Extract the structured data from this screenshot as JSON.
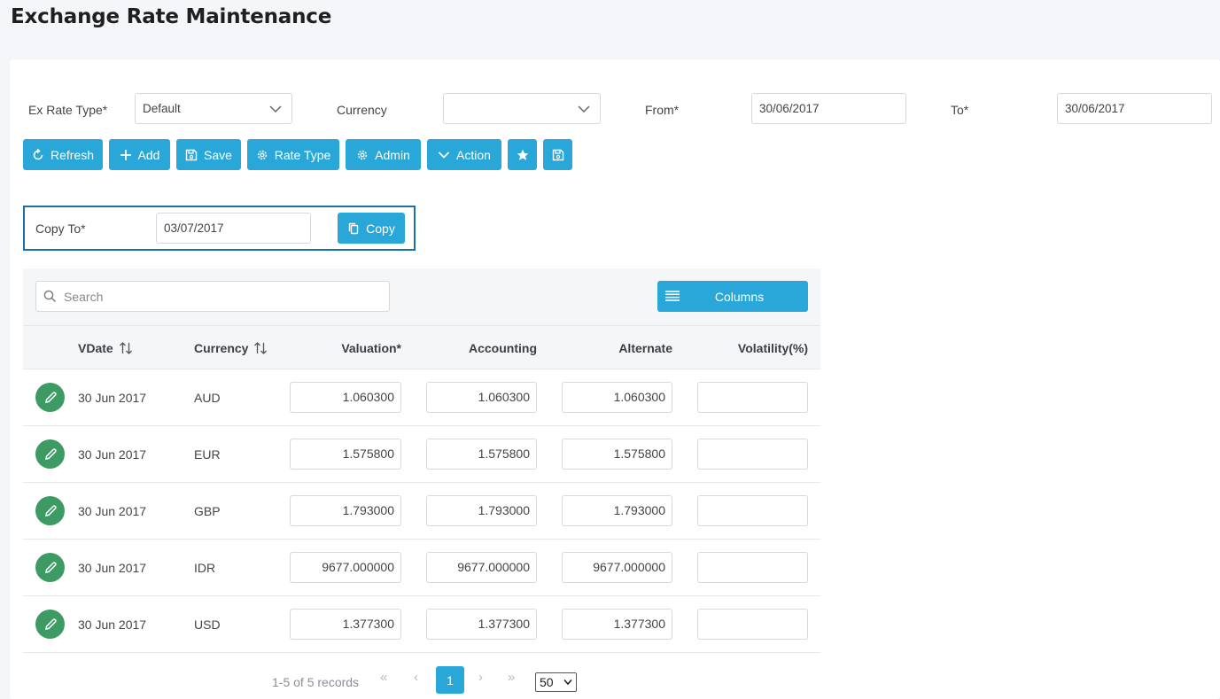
{
  "page": {
    "title": "Exchange Rate Maintenance"
  },
  "filters": {
    "ex_rate_type": {
      "label": "Ex Rate Type*",
      "value": "Default"
    },
    "currency": {
      "label": "Currency",
      "value": ""
    },
    "from": {
      "label": "From*",
      "value": "30/06/2017"
    },
    "to": {
      "label": "To*",
      "value": "30/06/2017"
    }
  },
  "toolbar": {
    "refresh": "Refresh",
    "add": "Add",
    "save": "Save",
    "rate_type": "Rate Type",
    "admin": "Admin",
    "action": "Action"
  },
  "copy": {
    "label": "Copy To*",
    "value": "03/07/2017",
    "button": "Copy"
  },
  "grid": {
    "search_placeholder": "Search",
    "columns_button": "Columns",
    "headers": {
      "vdate": "VDate",
      "currency": "Currency",
      "valuation": "Valuation*",
      "accounting": "Accounting",
      "alternate": "Alternate",
      "volatility": "Volatility(%)"
    },
    "rows": [
      {
        "vdate": "30 Jun 2017",
        "currency": "AUD",
        "valuation": "1.060300",
        "accounting": "1.060300",
        "alternate": "1.060300",
        "volatility": ""
      },
      {
        "vdate": "30 Jun 2017",
        "currency": "EUR",
        "valuation": "1.575800",
        "accounting": "1.575800",
        "alternate": "1.575800",
        "volatility": ""
      },
      {
        "vdate": "30 Jun 2017",
        "currency": "GBP",
        "valuation": "1.793000",
        "accounting": "1.793000",
        "alternate": "1.793000",
        "volatility": ""
      },
      {
        "vdate": "30 Jun 2017",
        "currency": "IDR",
        "valuation": "9677.000000",
        "accounting": "9677.000000",
        "alternate": "9677.000000",
        "volatility": ""
      },
      {
        "vdate": "30 Jun 2017",
        "currency": "USD",
        "valuation": "1.377300",
        "accounting": "1.377300",
        "alternate": "1.377300",
        "volatility": ""
      }
    ]
  },
  "pagination": {
    "records_text": "1-5 of 5 records",
    "first": "«",
    "prev": "‹",
    "current_page": "1",
    "next": "›",
    "last": "»",
    "page_size": "50"
  },
  "colors": {
    "primary": "#2aa7d9",
    "edit": "#3e9a63",
    "focus_border": "#1e6fa8"
  }
}
